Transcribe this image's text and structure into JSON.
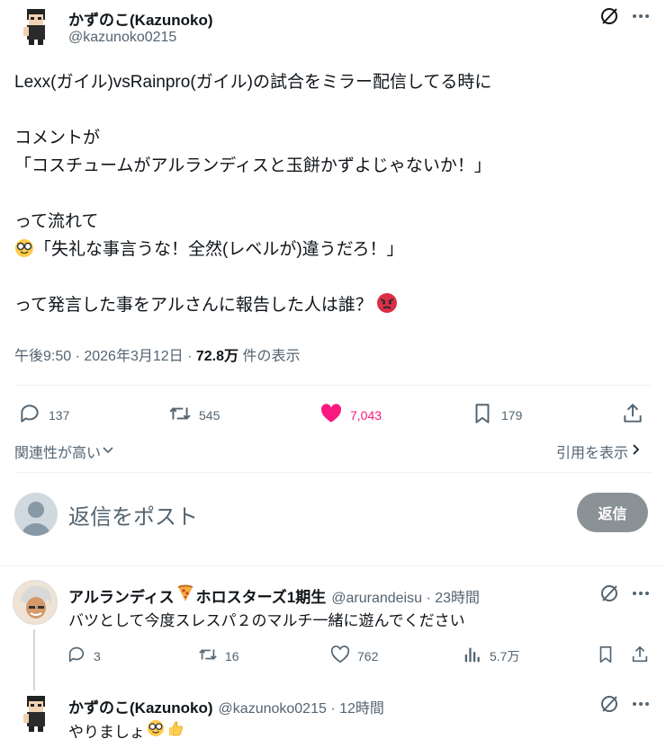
{
  "main_tweet": {
    "author_name": "かずのこ(Kazunoko)",
    "author_handle": "@kazunoko0215",
    "lines": [
      "Lexx(ガイル)vsRainpro(ガイル)の試合をミラー配信してる時に",
      "",
      "コメントが",
      "「コスチュームがアルランディスと玉餅かずよじゃないか！」",
      "",
      "って流れて",
      "「失礼な事言うな！全然(レベルが)違うだろ！」",
      "",
      "って発言した事をアルさんに報告した人は誰？"
    ],
    "meta_time": "午後9:50 · 2026年3月12日 · ",
    "meta_views": "72.8万",
    "meta_views_suffix": " 件の表示",
    "stats": {
      "replies": "137",
      "reposts": "545",
      "likes": "7,043",
      "bookmarks": "179"
    },
    "sort_label": "関連性が高い",
    "quotes_label": "引用を表示"
  },
  "reply_composer": {
    "placeholder": "返信をポスト",
    "button": "返信"
  },
  "replies": [
    {
      "author_name": "アルランディス",
      "author_name_suffix": "ホロスターズ1期生",
      "handle_time": "@arurandeisu · 23時間",
      "text": "バツとして今度スレスパ２のマルチ一緒に遊んでください",
      "stats": {
        "replies": "3",
        "reposts": "16",
        "likes": "762",
        "views": "5.7万"
      }
    },
    {
      "author_name": "かずのこ(Kazunoko)",
      "handle_time": "@kazunoko0215 · 12時間",
      "text": "やりましょ"
    }
  ],
  "colors": {
    "like_pink": "#f91880",
    "secondary_text": "#536471",
    "reply_button": "#8b9296"
  },
  "icons": [
    "grok-icon",
    "more-icon",
    "reply-icon",
    "repost-icon",
    "heart-icon",
    "bookmark-icon",
    "share-icon",
    "views-icon",
    "chevron-down-icon",
    "chevron-right-icon",
    "nerd-emoji",
    "angry-emoji",
    "pizza-emoji",
    "thumbs-up-emoji"
  ]
}
